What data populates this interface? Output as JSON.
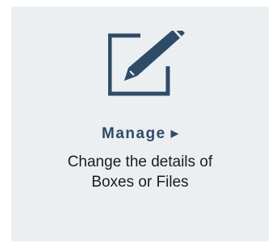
{
  "tile": {
    "title": "Manage",
    "arrow": "▶",
    "description_lines": [
      "Change the details of",
      "Boxes or Files"
    ],
    "icon": "edit-pencil-square-icon"
  },
  "colors": {
    "tile_background": "#eceff1",
    "accent": "#2f4b68",
    "text": "#1b1b1b"
  }
}
